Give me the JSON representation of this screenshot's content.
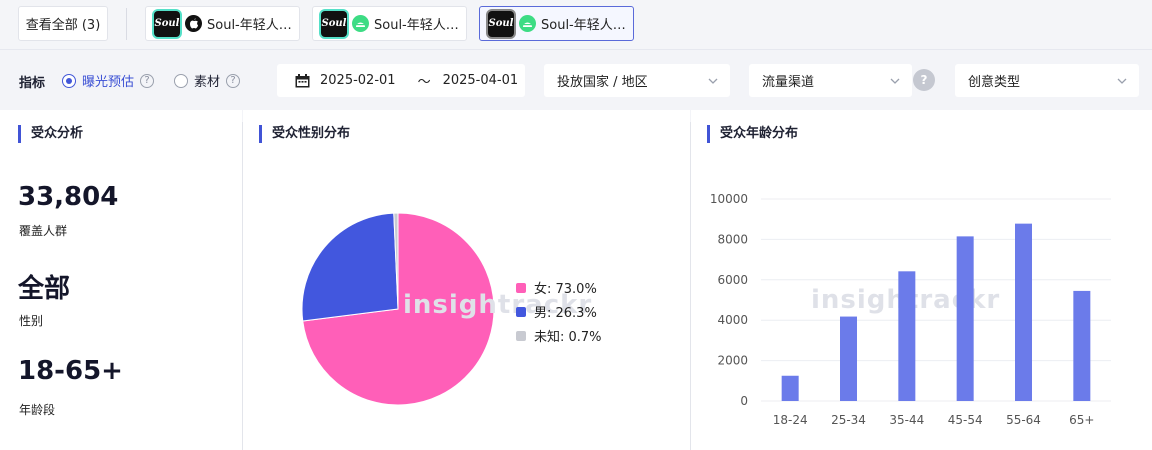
{
  "tabs": {
    "all_label": "查看全部 (3)",
    "apps": [
      {
        "label": "Soul-年轻人…",
        "logo_text": "Soul",
        "platform": "apple-icon"
      },
      {
        "label": "Soul-年轻人…",
        "logo_text": "Soul",
        "platform": "android-icon"
      },
      {
        "label": "Soul-年轻人…",
        "logo_text": "Soul",
        "platform": "android-icon"
      }
    ]
  },
  "filters": {
    "metric_label": "指标",
    "radio_exposure": "曝光预估",
    "radio_material": "素材",
    "help_glyph": "?",
    "date_start": "2025-02-01",
    "date_sep": "～",
    "date_end": "2025-04-01",
    "country_placeholder": "投放国家 / 地区",
    "channel_placeholder": "流量渠道",
    "creative_placeholder": "创意类型"
  },
  "audience": {
    "title": "受众分析",
    "coverage_value": "33,804",
    "coverage_label": "覆盖人群",
    "gender_value": "全部",
    "gender_label": "性别",
    "age_value": "18-65+",
    "age_label": "年龄段"
  },
  "gender_dist": {
    "title": "受众性别分布",
    "watermark": "insightrackr"
  },
  "age_dist": {
    "title": "受众年龄分布",
    "watermark": "insightrackr"
  },
  "colors": {
    "female": "#ff5fb8",
    "male": "#4257de",
    "unknown": "#c8cad1",
    "bar": "#6b7bea",
    "accent": "#4154d6"
  },
  "chart_data": [
    {
      "type": "pie",
      "categories": [
        "女",
        "男",
        "未知"
      ],
      "values": [
        73.0,
        26.3,
        0.7
      ],
      "legend_labels": [
        "女: 73.0%",
        "男: 26.3%",
        "未知: 0.7%"
      ],
      "title": "受众性别分布",
      "legend_position": "right"
    },
    {
      "type": "bar",
      "categories": [
        "18-24",
        "25-34",
        "35-44",
        "45-54",
        "55-64",
        "65+"
      ],
      "values": [
        1250,
        4180,
        6420,
        8150,
        8780,
        5450
      ],
      "yticks": [
        "0",
        "2000",
        "4000",
        "6000",
        "8000",
        "10000"
      ],
      "ylim": [
        0,
        10000
      ],
      "title": "受众年龄分布",
      "grid": true
    }
  ]
}
